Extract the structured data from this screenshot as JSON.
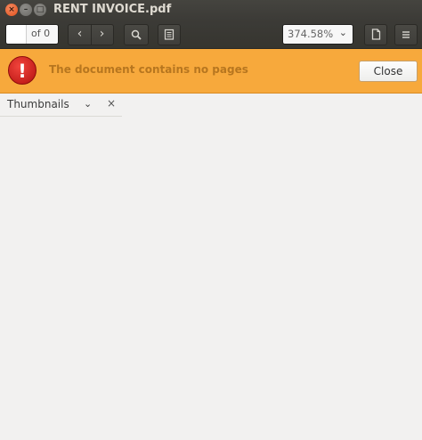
{
  "window": {
    "title": "RENT INVOICE.pdf",
    "controls": {
      "close_glyph": "×",
      "minimize_glyph": "–",
      "maximize_glyph": "□"
    }
  },
  "toolbar": {
    "page_input_value": "",
    "page_of_label": "of 0",
    "prev_glyph": "‹",
    "next_glyph": "›",
    "search_icon": "search-icon",
    "sidebar_icon": "sidebar-toggle-icon",
    "zoom_value": "374.58%",
    "zoom_arrow": "⌄",
    "document_icon": "document-icon",
    "menu_icon": "menu-icon"
  },
  "infobar": {
    "error_glyph": "!",
    "message": "The document contains no pages",
    "close_label": "Close",
    "colors": {
      "background": "#f7a93c",
      "message": "#b7761f"
    }
  },
  "sidebar": {
    "label": "Thumbnails",
    "chevron_glyph": "⌄",
    "close_glyph": "×"
  }
}
